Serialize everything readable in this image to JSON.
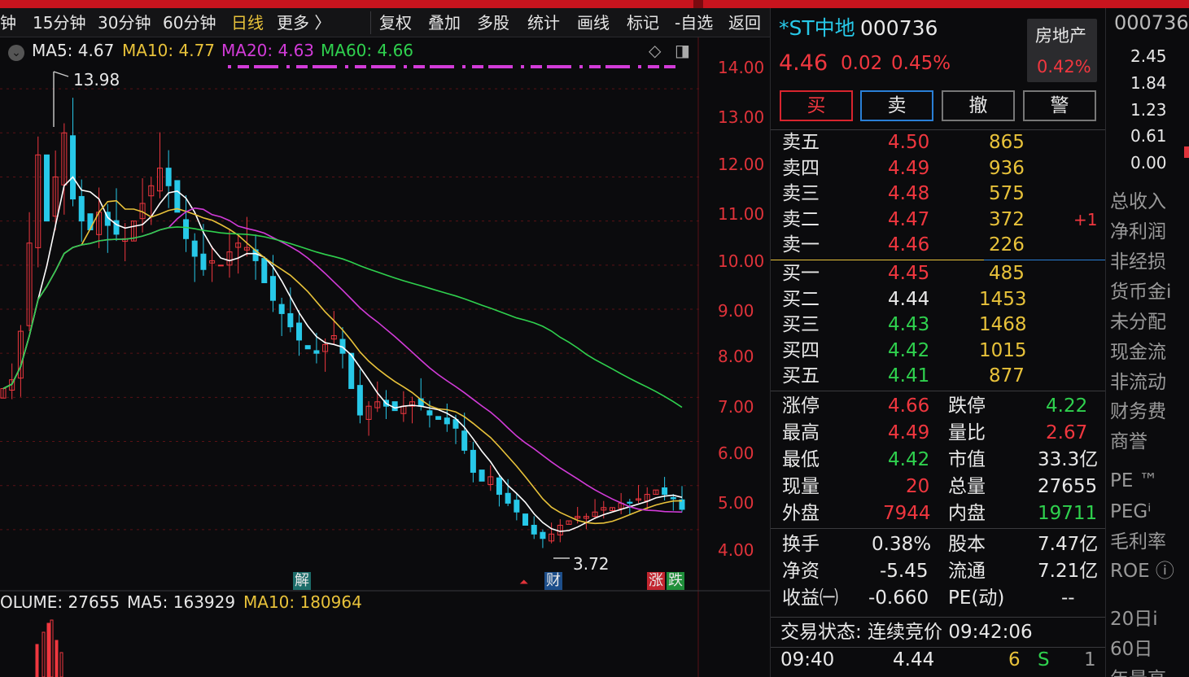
{
  "toolbar": {
    "periods": [
      "钟",
      "15分钟",
      "30分钟",
      "60分钟",
      "日线",
      "更多 〉"
    ],
    "active_period": "日线",
    "actions": [
      "复权",
      "叠加",
      "多股",
      "统计",
      "画线",
      "标记",
      "-自选",
      "返回"
    ]
  },
  "ma_legend": {
    "ma5": "MA5: 4.67",
    "ma10": "MA10: 4.77",
    "ma20": "MA20: 4.63",
    "ma60": "MA60: 4.66"
  },
  "volume_legend": {
    "volume": "OLUME: 27655",
    "ma5": "MA5: 163929",
    "ma10": "MA10: 180964"
  },
  "price_axis": [
    "14.00",
    "13.00",
    "12.00",
    "11.00",
    "10.00",
    "9.00",
    "8.00",
    "7.00",
    "6.00",
    "5.00",
    "4.00"
  ],
  "annotations": {
    "high": "13.98",
    "low": "3.72",
    "marker_jie": "解",
    "marker_cai": "财",
    "marker_zhang": "涨",
    "marker_die": "跌"
  },
  "stock": {
    "name": "*ST中地",
    "code": "000736",
    "price": "4.46",
    "change": "0.02",
    "change_pct": "0.45%",
    "sector": "房地产",
    "sector_pct": "0.42%"
  },
  "buttons": [
    "买",
    "卖",
    "撤",
    "警"
  ],
  "sell_orders": [
    {
      "label": "卖五",
      "price": "4.50",
      "vol": "865",
      "delta": ""
    },
    {
      "label": "卖四",
      "price": "4.49",
      "vol": "936",
      "delta": ""
    },
    {
      "label": "卖三",
      "price": "4.48",
      "vol": "575",
      "delta": ""
    },
    {
      "label": "卖二",
      "price": "4.47",
      "vol": "372",
      "delta": "+1"
    },
    {
      "label": "卖一",
      "price": "4.46",
      "vol": "226",
      "delta": ""
    }
  ],
  "buy_orders": [
    {
      "label": "买一",
      "price": "4.45",
      "vol": "485"
    },
    {
      "label": "买二",
      "price": "4.44",
      "vol": "1453"
    },
    {
      "label": "买三",
      "price": "4.43",
      "vol": "1468"
    },
    {
      "label": "买四",
      "price": "4.42",
      "vol": "1015"
    },
    {
      "label": "买五",
      "price": "4.41",
      "vol": "877"
    }
  ],
  "stats": {
    "limit_up_label": "涨停",
    "limit_up": "4.66",
    "limit_down_label": "跌停",
    "limit_down": "4.22",
    "high_label": "最高",
    "high": "4.49",
    "vol_ratio_label": "量比",
    "vol_ratio": "2.67",
    "low_label": "最低",
    "low": "4.42",
    "mktcap_label": "市值",
    "mktcap": "33.3亿",
    "cur_label": "现量",
    "cur": "20",
    "total_label": "总量",
    "total": "27655",
    "outer_label": "外盘",
    "outer": "7944",
    "inner_label": "内盘",
    "inner": "19711",
    "turnover_label": "换手",
    "turnover": "0.38%",
    "shares_label": "股本",
    "shares": "7.47亿",
    "nav_label": "净资",
    "nav": "-5.45",
    "float_label": "流通",
    "float": "7.21亿",
    "eps_label": "收益㈠",
    "eps": "-0.660",
    "pe_label": "PE(动)",
    "pe": "--"
  },
  "trade_status": "交易状态: 连续竞价 09:42:06",
  "tick": {
    "time": "09:40",
    "price": "4.44",
    "vol": "6",
    "side": "S",
    "count": "1"
  },
  "far_panel": {
    "code": "000736",
    "axis": [
      "2.45",
      "1.84",
      "1.23",
      "0.61",
      "0.00"
    ],
    "items": [
      "总收入",
      "净利润",
      "非经损",
      "货币金i",
      "未分配",
      "现金流",
      "非流动",
      "财务费",
      "商誉",
      "PE ™",
      "PEGⁱ",
      "毛利率",
      "ROE ⓘ",
      "20日i",
      "60日",
      "年最高"
    ]
  },
  "colors": {
    "up": "#f0373f",
    "down": "#27c8e8",
    "ma5": "#ffffff",
    "ma10": "#e8c23a",
    "ma20": "#d23bd8",
    "ma60": "#2fd14e"
  },
  "chart_data": {
    "type": "candlestick",
    "ylim": [
      3.5,
      14.5
    ],
    "close_series": [
      7.2,
      7.4,
      8.5,
      10.5,
      12.5,
      11.0,
      12.0,
      13.0,
      11.5,
      11.0,
      10.8,
      11.2,
      10.9,
      10.7,
      10.6,
      11.0,
      11.4,
      11.8,
      12.2,
      11.8,
      11.2,
      10.6,
      10.2,
      9.9,
      10.1,
      10.0,
      10.3,
      10.5,
      10.4,
      10.1,
      9.6,
      9.2,
      8.9,
      8.6,
      8.3,
      8.1,
      8.0,
      8.2,
      8.4,
      8.0,
      7.2,
      6.6,
      6.8,
      6.9,
      6.8,
      6.7,
      6.8,
      6.9,
      6.8,
      6.6,
      6.5,
      6.4,
      6.3,
      5.8,
      5.3,
      5.1,
      5.2,
      4.8,
      4.6,
      4.4,
      4.1,
      3.9,
      3.8,
      3.9,
      4.1,
      4.2,
      4.3,
      4.3,
      4.4,
      4.5,
      4.5,
      4.6,
      4.6,
      4.7,
      4.8,
      4.9,
      4.8,
      4.7,
      4.46
    ]
  }
}
